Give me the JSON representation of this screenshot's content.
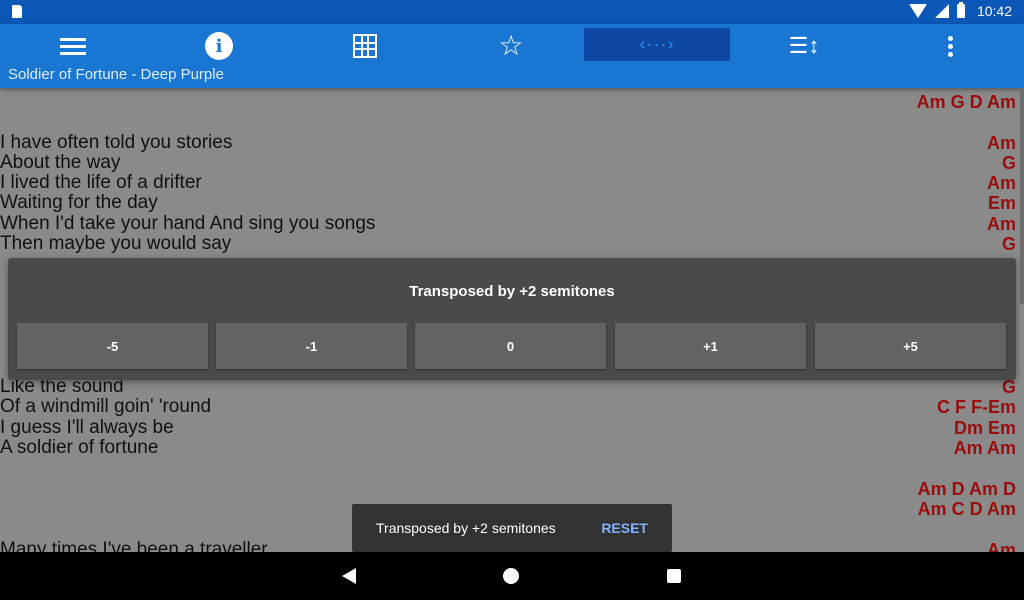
{
  "status_bar": {
    "time": "10:42"
  },
  "app_bar": {
    "title": "Soldier of Fortune - Deep Purple",
    "active_accent": "#2196f3",
    "transpose_glyph": "‹···›"
  },
  "lyrics": [
    {
      "text": "",
      "chords": "Am G D Am"
    },
    {
      "text": "I have often told you stories",
      "chords": "Am"
    },
    {
      "text": "About the way",
      "chords": "G"
    },
    {
      "text": "I lived the life of a drifter",
      "chords": "Am"
    },
    {
      "text": "Waiting for the day",
      "chords": "Em"
    },
    {
      "text": "When I'd take your hand And sing you songs",
      "chords": "Am"
    },
    {
      "text": "Then maybe you would say",
      "chords": "G"
    },
    {
      "text": "Like the sound",
      "chords": "G"
    },
    {
      "text": "Of a windmill goin' 'round",
      "chords": "C F F-Em"
    },
    {
      "text": "I guess I'll always be",
      "chords": "Dm Em"
    },
    {
      "text": "A soldier of fortune",
      "chords": "Am Am"
    },
    {
      "text": "",
      "chords": "Am D Am D"
    },
    {
      "text": "",
      "chords": "Am C D Am"
    },
    {
      "text": "Many times I've been a traveller",
      "chords": "Am"
    }
  ],
  "dialog": {
    "title": "Transposed by +2 semitones",
    "buttons": [
      "-5",
      "-1",
      "0",
      "+1",
      "+5"
    ]
  },
  "snackbar": {
    "message": "Transposed by +2 semitones",
    "action": "RESET"
  }
}
